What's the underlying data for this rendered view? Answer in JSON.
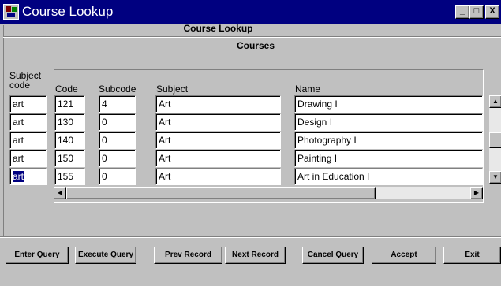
{
  "window": {
    "title": "Course Lookup",
    "minimize_glyph": "_",
    "maximize_glyph": "□",
    "close_glyph": "X"
  },
  "form": {
    "header": "Course Lookup",
    "block_title": "Courses"
  },
  "columns": {
    "subject_code": "Subject code",
    "code": "Code",
    "subcode": "Subcode",
    "subject": "Subject",
    "name": "Name"
  },
  "rows": [
    {
      "subject_code": "art",
      "code": "121",
      "subcode": "4",
      "subject": "Art",
      "name": "Drawing I"
    },
    {
      "subject_code": "art",
      "code": "130",
      "subcode": "0",
      "subject": "Art",
      "name": "Design I"
    },
    {
      "subject_code": "art",
      "code": "140",
      "subcode": "0",
      "subject": "Art",
      "name": "Photography I"
    },
    {
      "subject_code": "art",
      "code": "150",
      "subcode": "0",
      "subject": "Art",
      "name": "Painting I"
    },
    {
      "subject_code": "art",
      "code": "155",
      "subcode": "0",
      "subject": "Art",
      "name": "Art in Education I"
    }
  ],
  "scroll": {
    "up": "▲",
    "down": "▼",
    "left": "◀",
    "right": "▶"
  },
  "buttons": {
    "enter_query": "Enter Query",
    "execute_query": "Execute Query",
    "prev_record": "Prev Record",
    "next_record": "Next Record",
    "cancel_query": "Cancel Query",
    "accept": "Accept",
    "exit": "Exit"
  },
  "colors": {
    "title_bar": "#000080",
    "window_face": "#c0c0c0",
    "selection": "#000080"
  }
}
